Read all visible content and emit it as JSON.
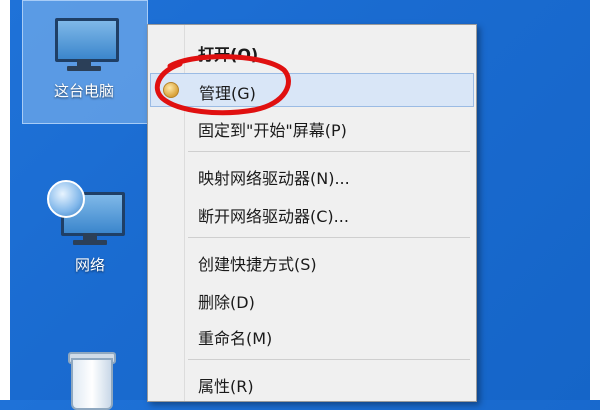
{
  "desktop": {
    "icons": [
      {
        "label": "这台电脑",
        "icon": "computer-icon"
      },
      {
        "label": "网络",
        "icon": "network-icon"
      },
      {
        "label": "",
        "icon": "recycle-bin-icon"
      }
    ]
  },
  "context_menu": {
    "items": [
      {
        "label": "打开(O)",
        "bold": true
      },
      {
        "label": "管理(G)",
        "highlighted": true,
        "icon": "shield-icon"
      },
      {
        "label": "固定到\"开始\"屏幕(P)"
      },
      {
        "label": "映射网络驱动器(N)..."
      },
      {
        "label": "断开网络驱动器(C)..."
      },
      {
        "label": "创建快捷方式(S)"
      },
      {
        "label": "删除(D)"
      },
      {
        "label": "重命名(M)"
      },
      {
        "label": "属性(R)"
      }
    ]
  },
  "colors": {
    "desktop_blue": "#1a6bd0",
    "annotation_red": "#e01010",
    "highlight": "#d9e6f7"
  }
}
